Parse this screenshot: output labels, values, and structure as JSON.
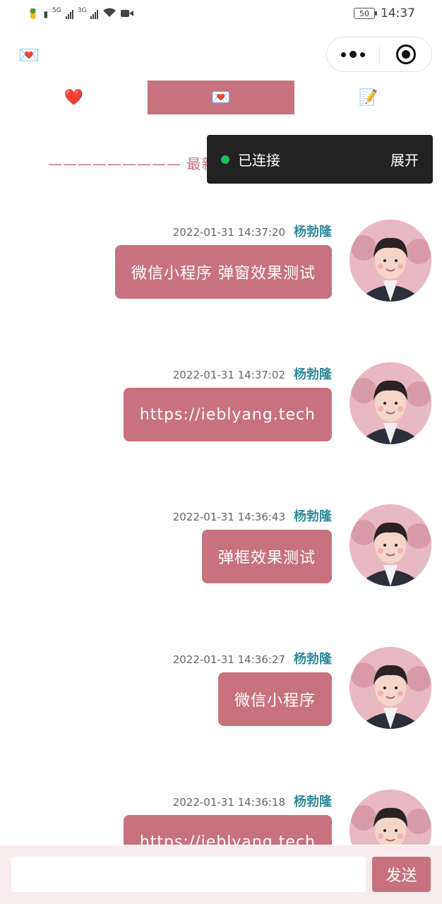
{
  "status_bar": {
    "signal_labels": [
      "5G",
      "3G"
    ],
    "battery": "50",
    "time": "14:37"
  },
  "nav": {
    "app_icon": "envelope-heart-icon"
  },
  "tabs": [
    {
      "icon": "❤️",
      "icon_name": "heart-icon",
      "active": false
    },
    {
      "icon": "💌",
      "icon_name": "love-letter-icon",
      "active": true
    },
    {
      "icon": "📝",
      "icon_name": "memo-icon",
      "active": false
    }
  ],
  "divider": {
    "text": "————————— 最新消息 —————————"
  },
  "toast": {
    "status": "已连接",
    "action": "展开"
  },
  "messages": [
    {
      "time": "2022-01-31 14:37:20",
      "name": "杨勃隆",
      "text": "微信小程序 弹窗效果测试"
    },
    {
      "time": "2022-01-31 14:37:02",
      "name": "杨勃隆",
      "text": "https://ieblyang.tech"
    },
    {
      "time": "2022-01-31 14:36:43",
      "name": "杨勃隆",
      "text": "弹框效果测试"
    },
    {
      "time": "2022-01-31 14:36:27",
      "name": "杨勃隆",
      "text": "微信小程序"
    },
    {
      "time": "2022-01-31 14:36:18",
      "name": "杨勃隆",
      "text": "https://ieblyang.tech"
    }
  ],
  "input": {
    "placeholder": "",
    "send_label": "发送"
  },
  "colors": {
    "accent": "#c8727f",
    "name": "#2f8a99",
    "toast_bg": "#222222",
    "connected_dot": "#19c05a",
    "input_bar": "#f8ecee"
  }
}
